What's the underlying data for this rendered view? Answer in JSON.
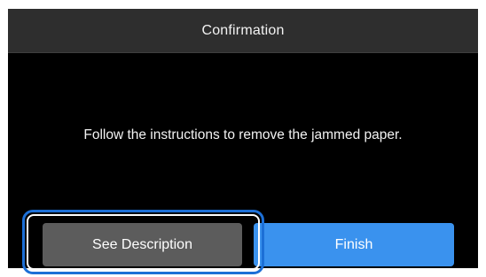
{
  "dialog": {
    "title": "Confirmation",
    "message": "Follow the instructions to remove the jammed paper."
  },
  "buttons": {
    "see_description": "See Description",
    "finish": "Finish"
  },
  "colors": {
    "title_bar": "#2e2e2e",
    "background": "#000000",
    "secondary_button": "#5c5c5c",
    "primary_button": "#3a92ee",
    "highlight": "#1c6fd6"
  }
}
